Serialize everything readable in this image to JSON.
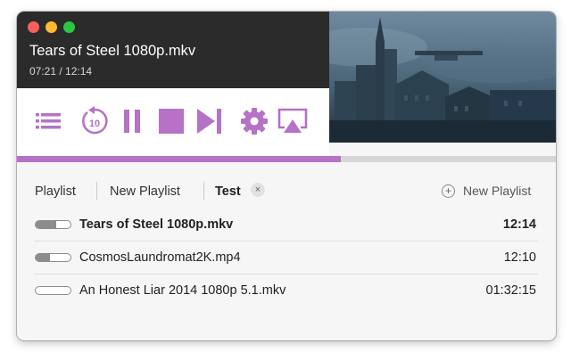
{
  "window": {
    "title": "Tears of Steel 1080p.mkv",
    "time": "07:21 / 12:14"
  },
  "playback": {
    "progress": 0.601
  },
  "controls": {
    "accent_color": "#b572c6",
    "buttons": [
      {
        "name": "playlist-icon"
      },
      {
        "name": "rewind-10-icon",
        "text": "10"
      },
      {
        "name": "pause-icon"
      },
      {
        "name": "stop-icon"
      },
      {
        "name": "next-icon"
      },
      {
        "name": "gear-icon"
      },
      {
        "name": "airplay-icon"
      }
    ]
  },
  "tabs": [
    {
      "label": "Playlist",
      "active": false
    },
    {
      "label": "New Playlist",
      "active": false
    },
    {
      "label": "Test",
      "active": true
    }
  ],
  "tab_close_glyph": "×",
  "new_playlist": {
    "label": "New Playlist",
    "icon": "plus-icon"
  },
  "playlist": [
    {
      "name": "Tears of Steel 1080p.mkv",
      "duration": "12:14",
      "current": true,
      "watched": 0.6
    },
    {
      "name": "CosmosLaundromat2K.mp4",
      "duration": "12:10",
      "current": false,
      "watched": 0.4
    },
    {
      "name": "An Honest Liar 2014 1080p 5.1.mkv",
      "duration": "01:32:15",
      "current": false,
      "watched": 0
    }
  ]
}
